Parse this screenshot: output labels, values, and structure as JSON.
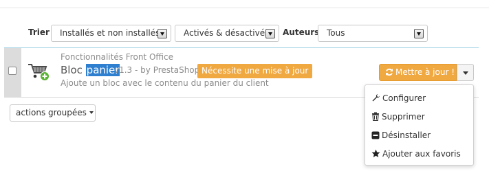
{
  "filters": {
    "sort_label": "Trier",
    "install_filter": "Installés et non installés",
    "status_filter": "Activés & désactivés",
    "author_label": "Auteurs",
    "author_filter": "Tous"
  },
  "module": {
    "category": "Fonctionnalités Front Office",
    "name_prefix": "Bloc",
    "name_highlight": "panier",
    "version": "v1.3",
    "by": "- by PrestaShop",
    "update_badge": "Nécessite une mise à jour",
    "description": "Ajoute un bloc avec le contenu du panier du client",
    "icon": "shopping-cart-add-icon"
  },
  "actions": {
    "update_label": "Mettre à jour !",
    "update_icon": "refresh-icon",
    "menu": [
      {
        "label": "Configurer",
        "icon": "wrench-icon"
      },
      {
        "label": "Supprimer",
        "icon": "trash-icon"
      },
      {
        "label": "Désinstaller",
        "icon": "minus-square-icon"
      },
      {
        "label": "Ajouter aux favoris",
        "icon": "star-icon"
      }
    ]
  },
  "bulk": {
    "label": "actions groupées"
  },
  "colors": {
    "accent_orange": "#f0a840",
    "highlight_blue": "#2f7fd1",
    "row_separator": "#a8d6e8",
    "muted_text": "#8c8c8c"
  }
}
